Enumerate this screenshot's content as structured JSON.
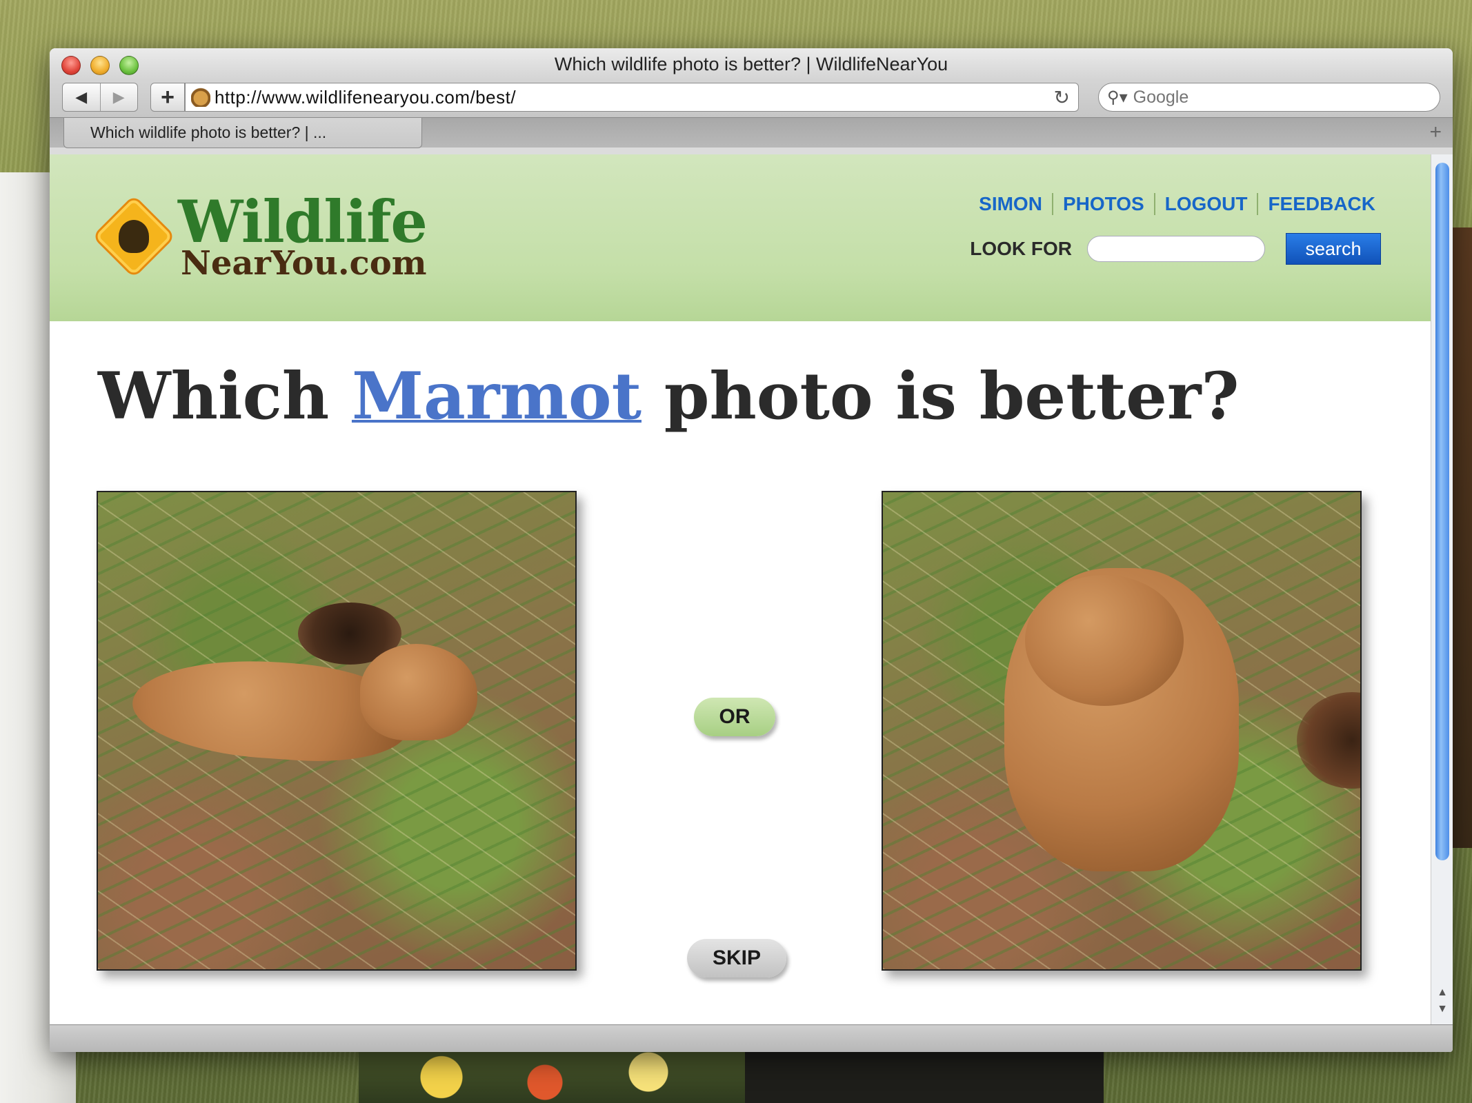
{
  "window": {
    "title": "Which wildlife photo is better? | WildlifeNearYou"
  },
  "toolbar": {
    "back_icon": "back-arrow-icon",
    "forward_icon": "forward-arrow-icon",
    "add_label": "+",
    "url": "http://www.wildlifenearyou.com/best/",
    "reload_icon": "reload-icon",
    "search_placeholder": "Google",
    "search_icon": "search-icon"
  },
  "tabs": [
    {
      "label": "Which wildlife photo is better? | ..."
    }
  ],
  "site": {
    "logo_line1": "Wildlife",
    "logo_line2": "NearYou.com",
    "nav": [
      "SIMON",
      "PHOTOS",
      "LOGOUT",
      "FEEDBACK"
    ],
    "look_for_label": "LOOK FOR",
    "search_button": "search"
  },
  "main": {
    "headline_prefix": "Which",
    "species": "Marmot",
    "headline_suffix": "photo is better?",
    "or_label": "OR",
    "skip_label": "SKIP"
  },
  "colors": {
    "header_green": "#c4dfa8",
    "nav_blue": "#1766c8",
    "search_button_blue": "#1a5fcc",
    "species_link": "#4a74c9"
  }
}
